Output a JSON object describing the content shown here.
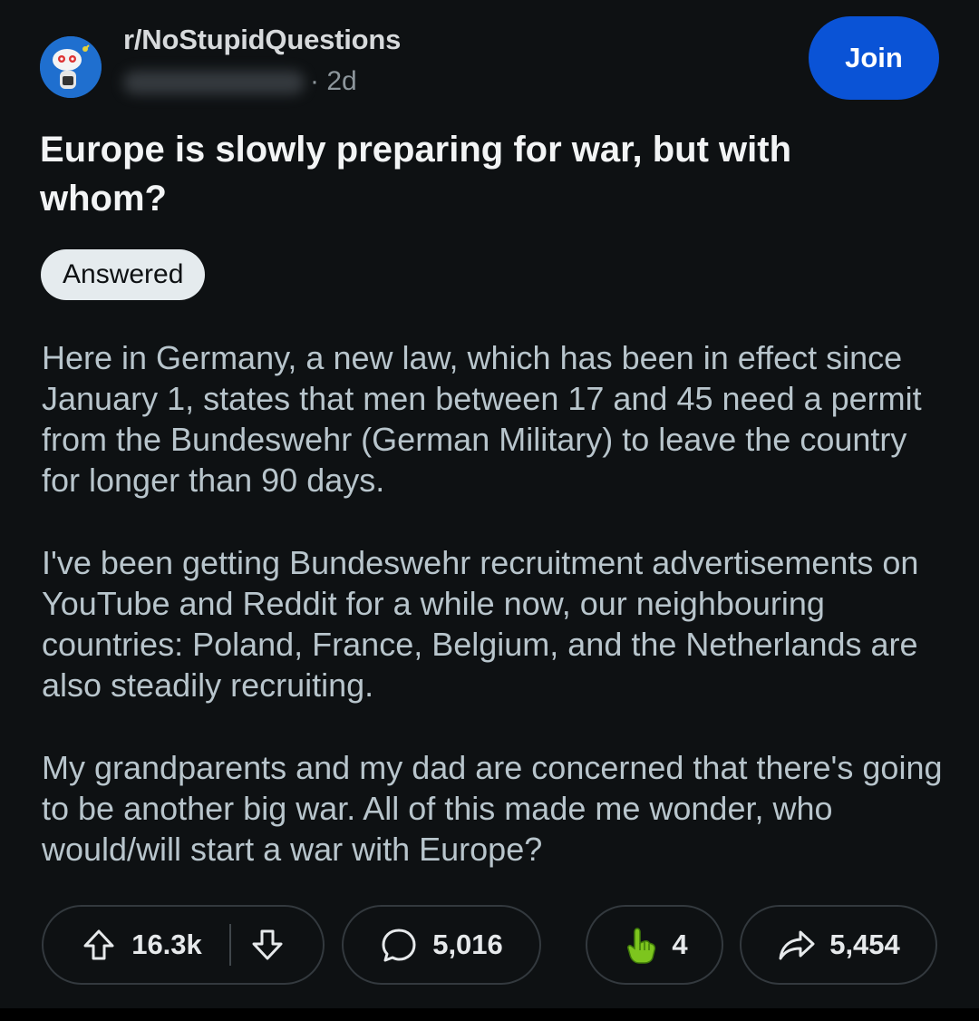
{
  "post": {
    "subreddit": "r/NoStupidQuestions",
    "age": "· 2d",
    "join_label": "Join",
    "title": "Europe is slowly preparing for war, but with whom?",
    "flair": "Answered",
    "paragraphs": [
      "Here in Germany, a new law, which has been in effect since January 1, states that men between 17 and 45 need a permit from the Bundeswehr (German Military) to leave the country for longer than 90 days.",
      "I've been getting Bundeswehr recruitment advertisements on YouTube and Reddit for a while now, our neighbouring countries: Poland, France, Belgium, and the Netherlands are also steadily recruiting.",
      "My grandparents and my dad are concerned that there's going to be another big war. All of this made me wonder, who would/will start a war with Europe?"
    ]
  },
  "actions": {
    "upvotes": "16.3k",
    "comments": "5,016",
    "awards": "4",
    "shares": "5,454"
  },
  "icons": {
    "upvote": "arrow-up-icon",
    "downvote": "arrow-down-icon",
    "comment": "speech-bubble-icon",
    "award": "pointing-hand-award-icon",
    "share": "share-arrow-icon"
  },
  "colors": {
    "background": "#0e1113",
    "join_button": "#0a53d6",
    "flair_bg": "#e5ebee",
    "body_text": "#b8c5cc",
    "award_green": "#7dc51e"
  }
}
